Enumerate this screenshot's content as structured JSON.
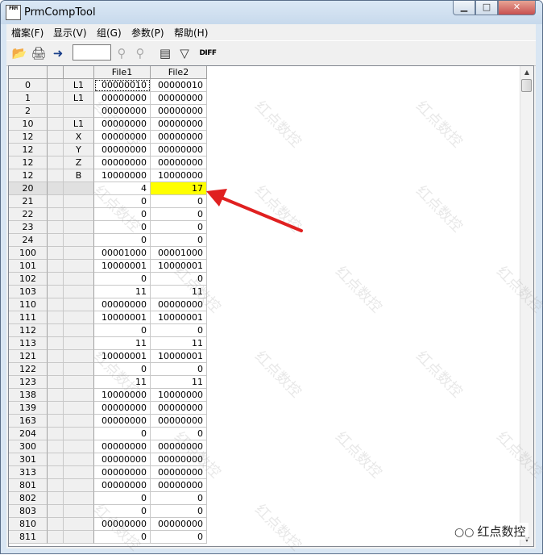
{
  "window": {
    "icon_text": "PRM",
    "title": "PrmCompTool",
    "buttons": {
      "minimize": "▁",
      "maximize": "□",
      "close": "✕"
    }
  },
  "menu": [
    "檔案(F)",
    "显示(V)",
    "组(G)",
    "参数(P)",
    "帮助(H)"
  ],
  "toolbar": {
    "icons": [
      "open-folder-icon",
      "print-icon",
      "import-icon",
      "zoom-in-icon",
      "zoom-out-icon",
      "compare-list-icon",
      "filter-icon"
    ],
    "diff_label": "DIFF",
    "input_value": ""
  },
  "grid": {
    "columns": [
      "",
      "",
      "",
      "File1",
      "File2"
    ],
    "rows": [
      [
        "0",
        "",
        "L1",
        "00000010",
        "00000010"
      ],
      [
        "1",
        "",
        "L1",
        "00000000",
        "00000000"
      ],
      [
        "2",
        "",
        "",
        "00000000",
        "00000000"
      ],
      [
        "10",
        "",
        "L1",
        "00000000",
        "00000000"
      ],
      [
        "12",
        "",
        "X",
        "00000000",
        "00000000"
      ],
      [
        "12",
        "",
        "Y",
        "00000000",
        "00000000"
      ],
      [
        "12",
        "",
        "Z",
        "00000000",
        "00000000"
      ],
      [
        "12",
        "",
        "B",
        "10000000",
        "10000000"
      ],
      [
        "20",
        "",
        "",
        "4",
        "17"
      ],
      [
        "21",
        "",
        "",
        "0",
        "0"
      ],
      [
        "22",
        "",
        "",
        "0",
        "0"
      ],
      [
        "23",
        "",
        "",
        "0",
        "0"
      ],
      [
        "24",
        "",
        "",
        "0",
        "0"
      ],
      [
        "100",
        "",
        "",
        "00001000",
        "00001000"
      ],
      [
        "101",
        "",
        "",
        "10000001",
        "10000001"
      ],
      [
        "102",
        "",
        "",
        "0",
        "0"
      ],
      [
        "103",
        "",
        "",
        "11",
        "11"
      ],
      [
        "110",
        "",
        "",
        "00000000",
        "00000000"
      ],
      [
        "111",
        "",
        "",
        "10000001",
        "10000001"
      ],
      [
        "112",
        "",
        "",
        "0",
        "0"
      ],
      [
        "113",
        "",
        "",
        "11",
        "11"
      ],
      [
        "121",
        "",
        "",
        "10000001",
        "10000001"
      ],
      [
        "122",
        "",
        "",
        "0",
        "0"
      ],
      [
        "123",
        "",
        "",
        "11",
        "11"
      ],
      [
        "138",
        "",
        "",
        "10000000",
        "10000000"
      ],
      [
        "139",
        "",
        "",
        "00000000",
        "00000000"
      ],
      [
        "163",
        "",
        "",
        "00000000",
        "00000000"
      ],
      [
        "204",
        "",
        "",
        "0",
        "0"
      ],
      [
        "300",
        "",
        "",
        "00000000",
        "00000000"
      ],
      [
        "301",
        "",
        "",
        "00000000",
        "00000000"
      ],
      [
        "313",
        "",
        "",
        "00000000",
        "00000000"
      ],
      [
        "801",
        "",
        "",
        "00000000",
        "00000000"
      ],
      [
        "802",
        "",
        "",
        "0",
        "0"
      ],
      [
        "803",
        "",
        "",
        "0",
        "0"
      ],
      [
        "810",
        "",
        "",
        "00000000",
        "00000000"
      ],
      [
        "811",
        "",
        "",
        "0",
        "0"
      ]
    ],
    "diff_row_index": 8,
    "selected_row_index": 8
  },
  "watermark_text": "红点数控",
  "brand": {
    "text": "红点数控",
    "icon": "wechat-icon"
  },
  "colors": {
    "diff_highlight": "#ffff00",
    "annotation_arrow": "#e02020"
  }
}
